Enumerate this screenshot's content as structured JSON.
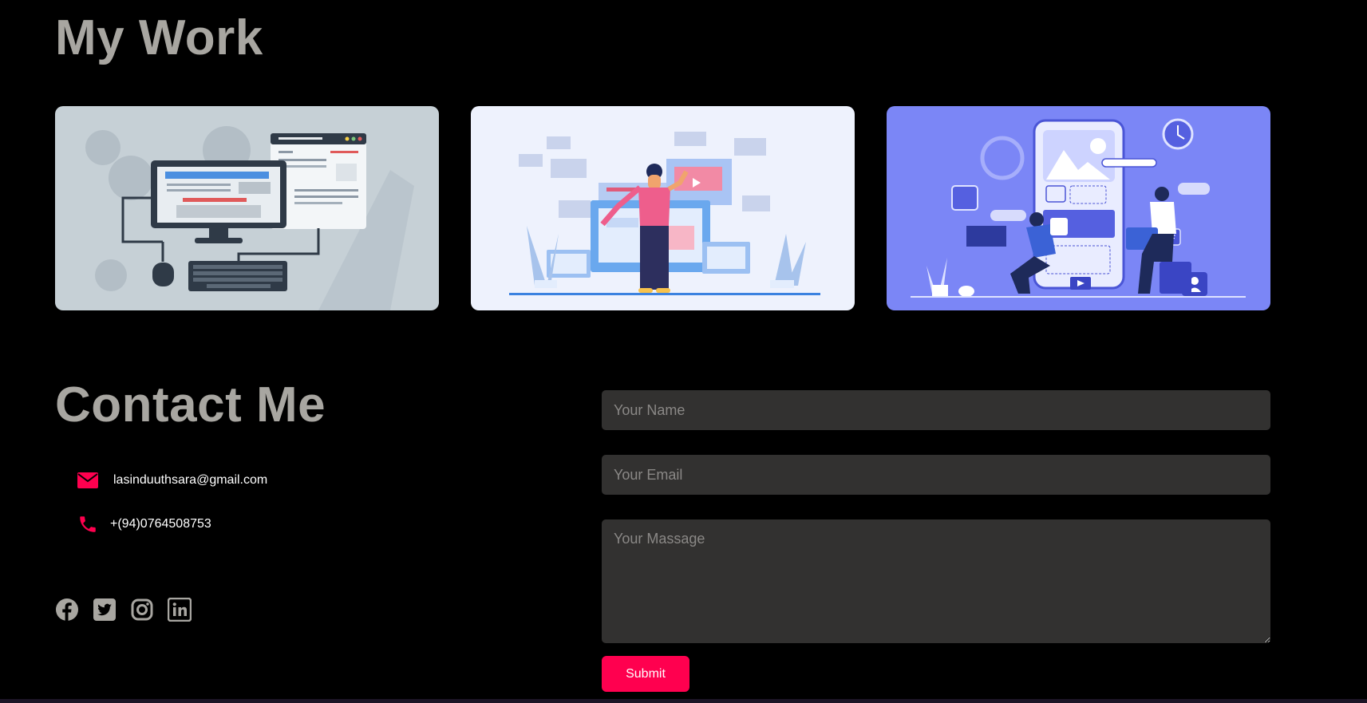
{
  "work": {
    "title": "My Work",
    "cards": [
      {
        "name": "web-development-illustration",
        "background": "#c6d0d6"
      },
      {
        "name": "web-design-illustration",
        "background": "#eef2fd"
      },
      {
        "name": "app-development-illustration",
        "background": "#7b86f6"
      }
    ]
  },
  "contact": {
    "title": "Contact Me",
    "email": "lasinduuthsara@gmail.com",
    "phone": "+(94)0764508753",
    "socials": [
      "facebook-icon",
      "twitter-icon",
      "instagram-icon",
      "linkedin-icon"
    ]
  },
  "form": {
    "name_placeholder": "Your Name",
    "email_placeholder": "Your Email",
    "message_placeholder": "Your Massage",
    "submit_label": "Submit"
  },
  "colors": {
    "accent": "#ff004f",
    "heading": "#a8a6a1",
    "field_bg": "#323130",
    "background": "#000000"
  }
}
